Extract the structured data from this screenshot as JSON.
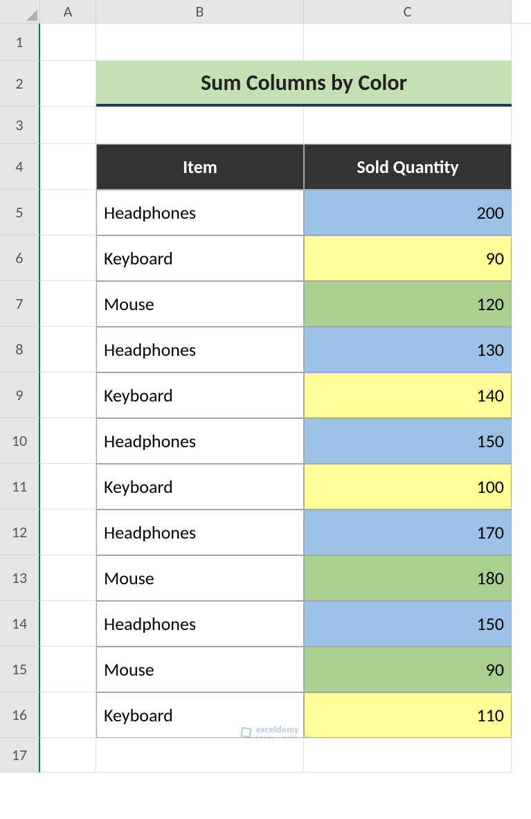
{
  "columns": [
    "A",
    "B",
    "C"
  ],
  "row_numbers": [
    1,
    2,
    3,
    4,
    5,
    6,
    7,
    8,
    9,
    10,
    11,
    12,
    13,
    14,
    15,
    16,
    17
  ],
  "title": "Sum Columns by Color",
  "headers": {
    "item": "Item",
    "qty": "Sold Quantity"
  },
  "rows": [
    {
      "item": "Headphones",
      "qty": 200,
      "color": "blue"
    },
    {
      "item": "Keyboard",
      "qty": 90,
      "color": "yellow"
    },
    {
      "item": "Mouse",
      "qty": 120,
      "color": "green"
    },
    {
      "item": "Headphones",
      "qty": 130,
      "color": "blue"
    },
    {
      "item": "Keyboard",
      "qty": 140,
      "color": "yellow"
    },
    {
      "item": "Headphones",
      "qty": 150,
      "color": "blue"
    },
    {
      "item": "Keyboard",
      "qty": 100,
      "color": "yellow"
    },
    {
      "item": "Headphones",
      "qty": 170,
      "color": "blue"
    },
    {
      "item": "Mouse",
      "qty": 180,
      "color": "green"
    },
    {
      "item": "Headphones",
      "qty": 150,
      "color": "blue"
    },
    {
      "item": "Mouse",
      "qty": 90,
      "color": "green"
    },
    {
      "item": "Keyboard",
      "qty": 110,
      "color": "yellow"
    }
  ],
  "watermark": {
    "name": "exceldemy",
    "tag": "EXCEL · DATA · BI"
  }
}
